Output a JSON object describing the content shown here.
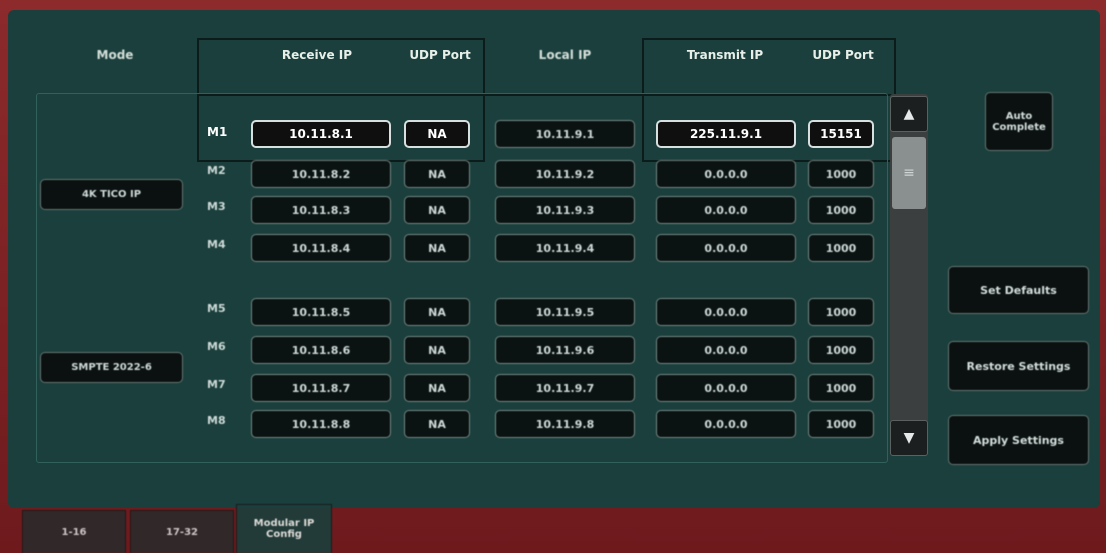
{
  "headers": {
    "mode": "Mode",
    "receive_ip": "Receive IP",
    "udp_port_rx": "UDP Port",
    "local_ip": "Local IP",
    "transmit_ip": "Transmit IP",
    "udp_port_tx": "UDP Port"
  },
  "modes": [
    "4K TICO IP",
    "SMPTE 2022-6"
  ],
  "rows": [
    {
      "label": "M1",
      "receive_ip": "10.11.8.1",
      "udp_rx": "NA",
      "local_ip": "10.11.9.1",
      "transmit_ip": "225.11.9.1",
      "udp_tx": "15151"
    },
    {
      "label": "M2",
      "receive_ip": "10.11.8.2",
      "udp_rx": "NA",
      "local_ip": "10.11.9.2",
      "transmit_ip": "0.0.0.0",
      "udp_tx": "1000"
    },
    {
      "label": "M3",
      "receive_ip": "10.11.8.3",
      "udp_rx": "NA",
      "local_ip": "10.11.9.3",
      "transmit_ip": "0.0.0.0",
      "udp_tx": "1000"
    },
    {
      "label": "M4",
      "receive_ip": "10.11.8.4",
      "udp_rx": "NA",
      "local_ip": "10.11.9.4",
      "transmit_ip": "0.0.0.0",
      "udp_tx": "1000"
    },
    {
      "label": "M5",
      "receive_ip": "10.11.8.5",
      "udp_rx": "NA",
      "local_ip": "10.11.9.5",
      "transmit_ip": "0.0.0.0",
      "udp_tx": "1000"
    },
    {
      "label": "M6",
      "receive_ip": "10.11.8.6",
      "udp_rx": "NA",
      "local_ip": "10.11.9.6",
      "transmit_ip": "0.0.0.0",
      "udp_tx": "1000"
    },
    {
      "label": "M7",
      "receive_ip": "10.11.8.7",
      "udp_rx": "NA",
      "local_ip": "10.11.9.7",
      "transmit_ip": "0.0.0.0",
      "udp_tx": "1000"
    },
    {
      "label": "M8",
      "receive_ip": "10.11.8.8",
      "udp_rx": "NA",
      "local_ip": "10.11.9.8",
      "transmit_ip": "0.0.0.0",
      "udp_tx": "1000"
    }
  ],
  "buttons": {
    "auto_complete": "Auto\nComplete",
    "set_defaults": "Set Defaults",
    "restore_settings": "Restore Settings",
    "apply_settings": "Apply Settings"
  },
  "scroll": {
    "up_icon": "up-arrow",
    "down_icon": "down-arrow",
    "thumb_icon": "grip-lines"
  },
  "tabs": [
    {
      "label": "1-16"
    },
    {
      "label": "17-32"
    },
    {
      "label": "Modular IP\nConfig",
      "selected": true
    }
  ]
}
